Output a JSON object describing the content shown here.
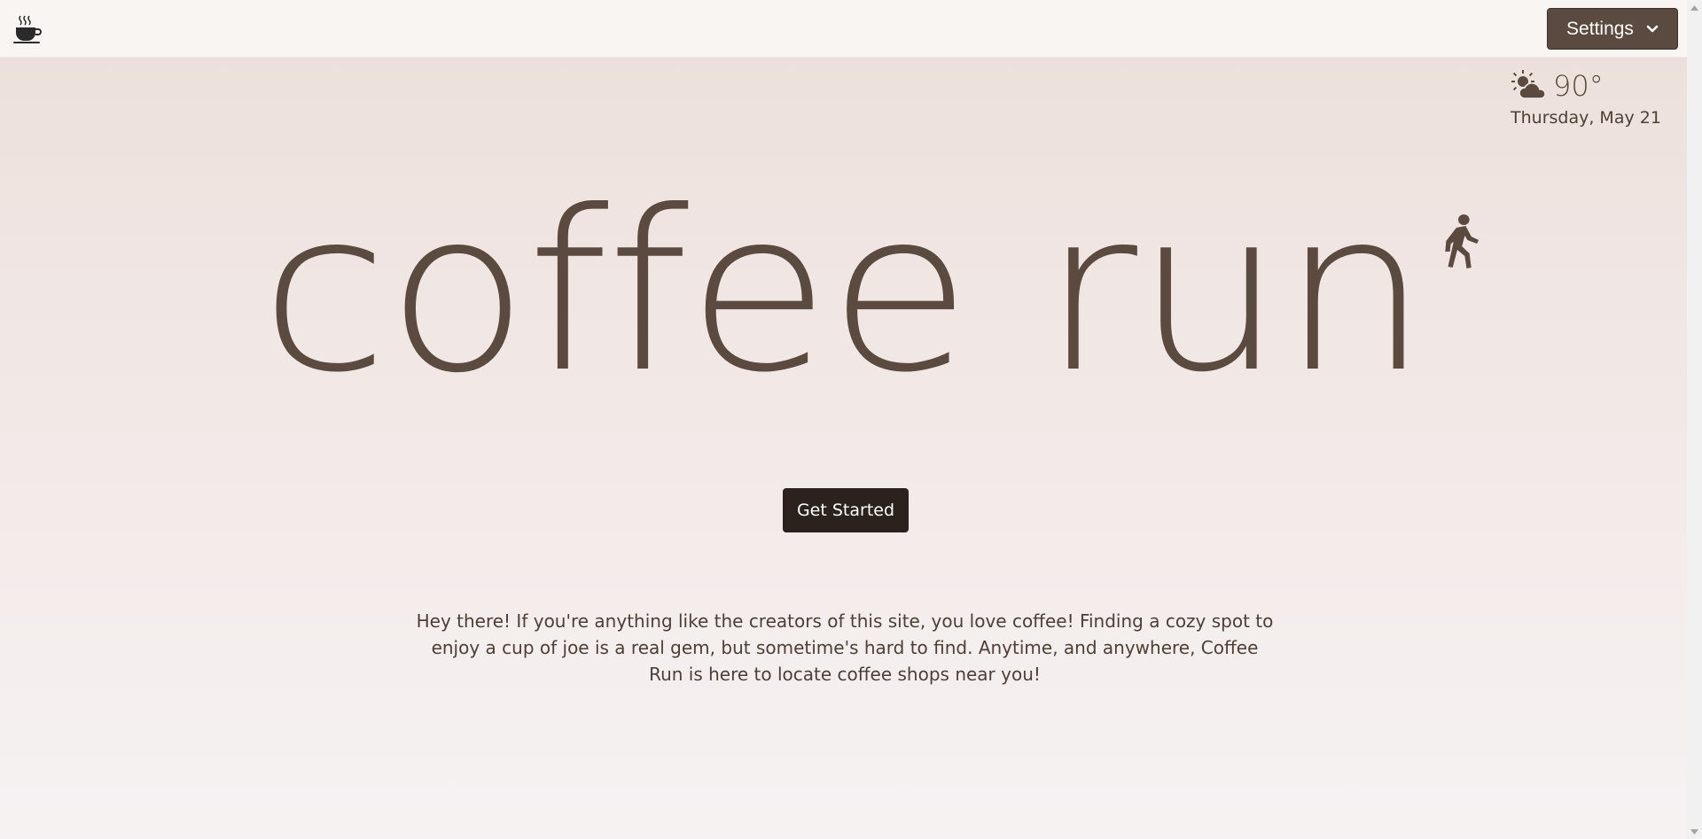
{
  "nav": {
    "logo_icon": "coffee-cup-icon",
    "settings_label": "Settings",
    "settings_chevron": "chevron-down-icon"
  },
  "weather": {
    "icon": "partly-cloudy-icon",
    "temperature": "90°",
    "date": "Thursday, May 21"
  },
  "hero": {
    "title": "coffee run",
    "title_icon": "walking-person-icon",
    "cta_label": "Get Started",
    "intro": "Hey there! If you're anything like the creators of this site, you love coffee! Finding a cozy spot to enjoy a cup of joe is a real gem, but sometime's hard to find. Anytime, and anywhere, Coffee Run is here to locate coffee shops near you!"
  },
  "colors": {
    "primary_brown": "#5b4a3f",
    "dark_button": "#2c221d",
    "navbar_bg": "#f8f5f2"
  }
}
